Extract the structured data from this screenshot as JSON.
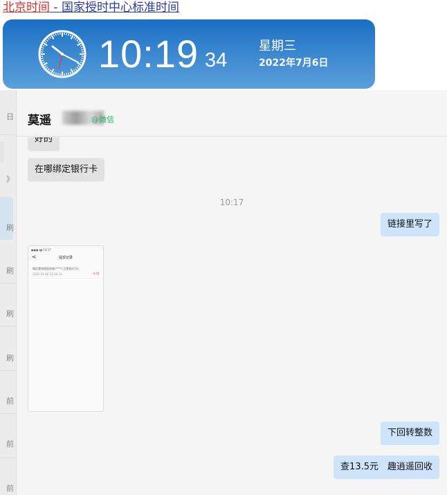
{
  "top_link": {
    "red_text": "北京时间",
    "blue_text": " - 国家授时中心标准时间"
  },
  "clock": {
    "time": "10:19",
    "seconds": "34",
    "weekday": "星期三",
    "date": "2022年7月6日"
  },
  "colors": {
    "banner_top": "#1a6fc4",
    "banner_bottom": "#5ca0db",
    "bubble_out": "#cde4fb",
    "bubble_in": "#e2e2e2",
    "wechat_green": "#2aae67"
  },
  "sidebar": {
    "items": [
      "日",
      "》",
      "刷",
      "刷",
      "刷",
      "刷",
      "前",
      "前",
      "前"
    ]
  },
  "chat": {
    "contact_name": "莫遥",
    "contact_suffix": "@微信",
    "messages": {
      "m0": "好的",
      "m1": "在哪绑定银行卡",
      "time": "10:17",
      "m2": "链接里写了",
      "m3": "下回转整数",
      "m4": "查13.5元　趣逍遥回收"
    },
    "image": {
      "status": "●●●  ▮▮ 10:17",
      "title": "提现记录",
      "back": "<",
      "line1": "微信零钱提现到账(****)  已提现4.5元",
      "line2": "2022-07-06 10:16:33",
      "amount": "-4.50"
    }
  }
}
